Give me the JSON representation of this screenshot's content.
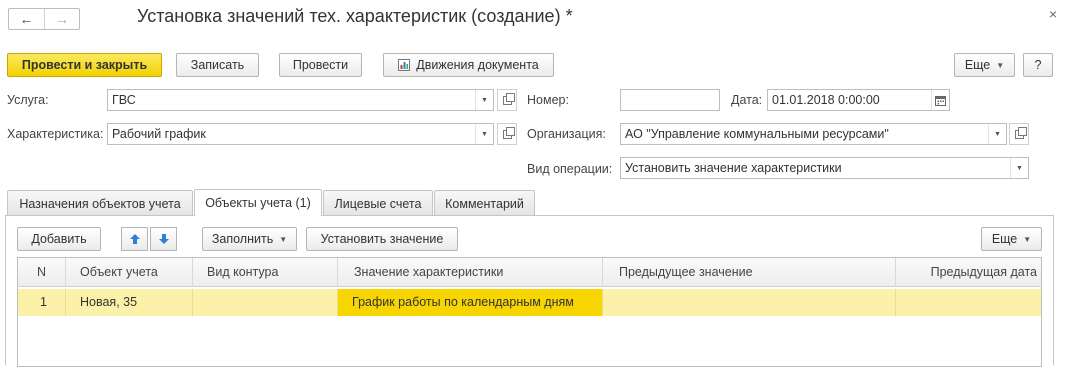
{
  "window": {
    "title": "Установка значений тех. характеристик (создание) *",
    "nav_back": "←",
    "nav_forward": "→",
    "close": "×"
  },
  "toolbar": {
    "post_close": "Провести и закрыть",
    "save": "Записать",
    "post": "Провести",
    "movements": "Движения документа",
    "more": "Еще",
    "help": "?"
  },
  "form": {
    "service_label": "Услуга:",
    "service_value": "ГВС",
    "characteristic_label": "Характеристика:",
    "characteristic_value": "Рабочий график",
    "number_label": "Номер:",
    "number_value": "",
    "date_label": "Дата:",
    "date_value": "01.01.2018  0:00:00",
    "organization_label": "Организация:",
    "organization_value": "АО \"Управление коммунальными ресурсами\"",
    "operation_label": "Вид операции:",
    "operation_value": "Установить значение характеристики"
  },
  "tabs": [
    {
      "label": "Назначения объектов учета"
    },
    {
      "label": "Объекты учета (1)"
    },
    {
      "label": "Лицевые счета"
    },
    {
      "label": "Комментарий"
    }
  ],
  "table_toolbar": {
    "add": "Добавить",
    "up": "↑",
    "down": "↓",
    "fill": "Заполнить",
    "set_value": "Установить значение",
    "more": "Еще"
  },
  "table": {
    "headers": [
      "N",
      "Объект учета",
      "Вид контура",
      "Значение характеристики",
      "Предыдущее значение",
      "Предыдущая дата"
    ],
    "rows": [
      {
        "n": "1",
        "object": "Новая, 35",
        "contour": "",
        "value": "График работы по календарным дням",
        "prev_value": "",
        "prev_date": ""
      }
    ]
  },
  "colors": {
    "primary_button": "#f2d300",
    "selected_row": "#fbf1a9",
    "selected_cell": "#f7d500",
    "arrow_blue": "#2f7fd3"
  },
  "icons": {
    "movements": "document-movements-icon",
    "calendar": "calendar-icon",
    "open": "open-form-icon",
    "dropdown": "chevron-down-icon"
  }
}
